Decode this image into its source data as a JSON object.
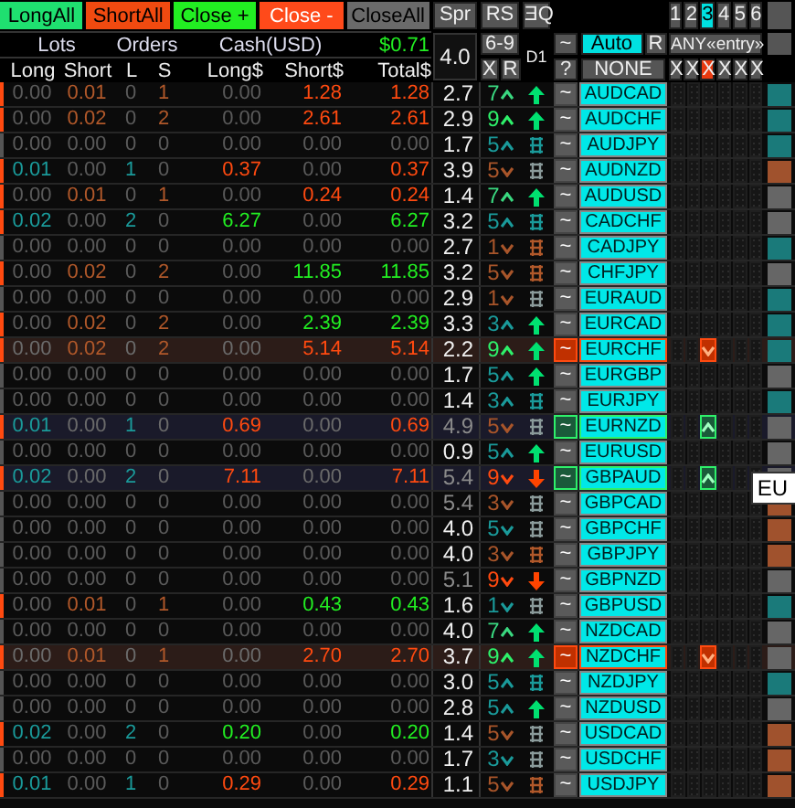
{
  "actions": [
    {
      "label": "LongAll",
      "kind": "long"
    },
    {
      "label": "ShortAll",
      "kind": "short"
    },
    {
      "label": "Close +",
      "kind": "close_profit"
    },
    {
      "label": "Close -",
      "kind": "close_loss"
    },
    {
      "label": "CloseAll",
      "kind": "close_all"
    }
  ],
  "sort_buttons": [
    "Spr",
    "RS",
    "ƎQ"
  ],
  "pages": [
    {
      "label": "1",
      "selected": false
    },
    {
      "label": "2",
      "selected": false
    },
    {
      "label": "3",
      "selected": true
    },
    {
      "label": "4",
      "selected": false
    },
    {
      "label": "5",
      "selected": false
    },
    {
      "label": "6",
      "selected": false
    }
  ],
  "summary": {
    "lots": "Lots",
    "orders": "Orders",
    "cash": "Cash(USD)",
    "total": "$0.71"
  },
  "column_headers": [
    "Long",
    "Short",
    "L",
    "S",
    "Long$",
    "Short$",
    "Total$"
  ],
  "spread": "4.0",
  "rs_range": "6-9",
  "rs_buttons": [
    "X",
    "R"
  ],
  "timeframe": "D1",
  "mode_buttons": [
    "~",
    "?"
  ],
  "auto": {
    "label": "Auto",
    "selected": true
  },
  "auto_reset": "R",
  "filter": "NONE",
  "entry": "ANY«entry»",
  "slot_buttons": [
    {
      "label": "X",
      "selected": false
    },
    {
      "label": "X",
      "selected": false
    },
    {
      "label": "X",
      "selected": true
    },
    {
      "label": "X",
      "selected": false
    },
    {
      "label": "X",
      "selected": false
    },
    {
      "label": "X",
      "selected": false
    }
  ],
  "rows": [
    {
      "pair": "AUDCAD",
      "toggle": "~",
      "long": "0.00",
      "short": "0.01",
      "l": "0",
      "s": "1",
      "long_usd": "0.00",
      "short_usd": "1.28",
      "total": "1.28",
      "has_long": false,
      "has_short": true,
      "profit": false,
      "spread": "2.7",
      "wide_spread": false,
      "rs": {
        "value": "7",
        "kind": "up",
        "color": "#3ad880"
      },
      "trend": {
        "kind": "up",
        "color": "#00e070"
      },
      "sell_signal": false,
      "buy_signal": false,
      "slots": [
        {
          "kind": "off"
        },
        {
          "kind": "off"
        },
        {
          "kind": "off"
        },
        {
          "kind": "off"
        },
        {
          "kind": "off"
        },
        {
          "kind": "off"
        }
      ],
      "tag": {
        "color": "#1a7a7a"
      }
    },
    {
      "pair": "AUDCHF",
      "toggle": "~",
      "long": "0.00",
      "short": "0.02",
      "l": "0",
      "s": "2",
      "long_usd": "0.00",
      "short_usd": "2.61",
      "total": "2.61",
      "has_long": false,
      "has_short": true,
      "profit": false,
      "spread": "2.9",
      "wide_spread": false,
      "rs": {
        "value": "9",
        "kind": "up",
        "color": "#2ef06a"
      },
      "trend": {
        "kind": "up",
        "color": "#00e070"
      },
      "sell_signal": false,
      "buy_signal": false,
      "slots": [
        {
          "kind": "off"
        },
        {
          "kind": "off"
        },
        {
          "kind": "off"
        },
        {
          "kind": "off"
        },
        {
          "kind": "off"
        },
        {
          "kind": "off"
        }
      ],
      "tag": {
        "color": "#1a7a7a"
      }
    },
    {
      "pair": "AUDJPY",
      "toggle": "~",
      "long": "0.00",
      "short": "0.00",
      "l": "0",
      "s": "0",
      "long_usd": "0.00",
      "short_usd": "0.00",
      "total": "0.00",
      "has_long": false,
      "has_short": false,
      "profit": false,
      "spread": "1.7",
      "wide_spread": false,
      "rs": {
        "value": "5",
        "kind": "up",
        "color": "#1a9a9a"
      },
      "trend": {
        "kind": "mixed",
        "color": "#1a9a9a"
      },
      "sell_signal": false,
      "buy_signal": false,
      "slots": [
        {
          "kind": "off"
        },
        {
          "kind": "off"
        },
        {
          "kind": "off"
        },
        {
          "kind": "off"
        },
        {
          "kind": "off"
        },
        {
          "kind": "off"
        }
      ],
      "tag": {
        "color": "#1a7a7a"
      }
    },
    {
      "pair": "AUDNZD",
      "toggle": "~",
      "long": "0.01",
      "short": "0.00",
      "l": "1",
      "s": "0",
      "long_usd": "0.37",
      "short_usd": "0.00",
      "total": "0.37",
      "has_long": true,
      "has_short": false,
      "profit": false,
      "spread": "3.9",
      "wide_spread": false,
      "rs": {
        "value": "5",
        "kind": "down",
        "color": "#a8552a"
      },
      "trend": {
        "kind": "mixed",
        "color": "#8a9a9a"
      },
      "sell_signal": false,
      "buy_signal": false,
      "slots": [
        {
          "kind": "off"
        },
        {
          "kind": "off"
        },
        {
          "kind": "off"
        },
        {
          "kind": "off"
        },
        {
          "kind": "off"
        },
        {
          "kind": "off"
        }
      ],
      "tag": {
        "color": "#a0522d"
      }
    },
    {
      "pair": "AUDUSD",
      "toggle": "~",
      "long": "0.00",
      "short": "0.01",
      "l": "0",
      "s": "1",
      "long_usd": "0.00",
      "short_usd": "0.24",
      "total": "0.24",
      "has_long": false,
      "has_short": true,
      "profit": false,
      "spread": "1.4",
      "wide_spread": false,
      "rs": {
        "value": "7",
        "kind": "up",
        "color": "#3ad880"
      },
      "trend": {
        "kind": "up",
        "color": "#00e070"
      },
      "sell_signal": false,
      "buy_signal": false,
      "slots": [
        {
          "kind": "off"
        },
        {
          "kind": "off"
        },
        {
          "kind": "off"
        },
        {
          "kind": "off"
        },
        {
          "kind": "off"
        },
        {
          "kind": "off"
        }
      ],
      "tag": {
        "color": "#666666"
      }
    },
    {
      "pair": "CADCHF",
      "toggle": "~",
      "long": "0.02",
      "short": "0.00",
      "l": "2",
      "s": "0",
      "long_usd": "6.27",
      "short_usd": "0.00",
      "total": "6.27",
      "has_long": true,
      "has_short": false,
      "profit": true,
      "spread": "3.2",
      "wide_spread": false,
      "rs": {
        "value": "5",
        "kind": "up",
        "color": "#1a9a9a"
      },
      "trend": {
        "kind": "mixed",
        "color": "#1a9a9a"
      },
      "sell_signal": false,
      "buy_signal": false,
      "slots": [
        {
          "kind": "off"
        },
        {
          "kind": "off"
        },
        {
          "kind": "off"
        },
        {
          "kind": "off"
        },
        {
          "kind": "off"
        },
        {
          "kind": "off"
        }
      ],
      "tag": {
        "color": "#666666"
      }
    },
    {
      "pair": "CADJPY",
      "toggle": "~",
      "long": "0.00",
      "short": "0.00",
      "l": "0",
      "s": "0",
      "long_usd": "0.00",
      "short_usd": "0.00",
      "total": "0.00",
      "has_long": false,
      "has_short": false,
      "profit": false,
      "spread": "2.7",
      "wide_spread": false,
      "rs": {
        "value": "1",
        "kind": "down",
        "color": "#a8552a"
      },
      "trend": {
        "kind": "mixed",
        "color": "#b0582a"
      },
      "sell_signal": false,
      "buy_signal": false,
      "slots": [
        {
          "kind": "off"
        },
        {
          "kind": "off"
        },
        {
          "kind": "off"
        },
        {
          "kind": "off"
        },
        {
          "kind": "off"
        },
        {
          "kind": "off"
        }
      ],
      "tag": {
        "color": "#1a7a7a"
      }
    },
    {
      "pair": "CHFJPY",
      "toggle": "~",
      "long": "0.00",
      "short": "0.02",
      "l": "0",
      "s": "2",
      "long_usd": "0.00",
      "short_usd": "11.85",
      "total": "11.85",
      "has_long": false,
      "has_short": true,
      "profit": true,
      "spread": "3.2",
      "wide_spread": false,
      "rs": {
        "value": "5",
        "kind": "down",
        "color": "#a8552a"
      },
      "trend": {
        "kind": "mixed",
        "color": "#b0582a"
      },
      "sell_signal": false,
      "buy_signal": false,
      "slots": [
        {
          "kind": "off"
        },
        {
          "kind": "off"
        },
        {
          "kind": "off"
        },
        {
          "kind": "off"
        },
        {
          "kind": "off"
        },
        {
          "kind": "off"
        }
      ],
      "tag": {
        "color": "#666666"
      }
    },
    {
      "pair": "EURAUD",
      "toggle": "~",
      "long": "0.00",
      "short": "0.00",
      "l": "0",
      "s": "0",
      "long_usd": "0.00",
      "short_usd": "0.00",
      "total": "0.00",
      "has_long": false,
      "has_short": false,
      "profit": false,
      "spread": "2.9",
      "wide_spread": false,
      "rs": {
        "value": "1",
        "kind": "down",
        "color": "#a8552a"
      },
      "trend": {
        "kind": "mixed",
        "color": "#8a9a9a"
      },
      "sell_signal": false,
      "buy_signal": false,
      "slots": [
        {
          "kind": "off"
        },
        {
          "kind": "off"
        },
        {
          "kind": "off"
        },
        {
          "kind": "off"
        },
        {
          "kind": "off"
        },
        {
          "kind": "off"
        }
      ],
      "tag": {
        "color": "#1a7a7a"
      }
    },
    {
      "pair": "EURCAD",
      "toggle": "~",
      "long": "0.00",
      "short": "0.02",
      "l": "0",
      "s": "2",
      "long_usd": "0.00",
      "short_usd": "2.39",
      "total": "2.39",
      "has_long": false,
      "has_short": true,
      "profit": true,
      "spread": "3.3",
      "wide_spread": false,
      "rs": {
        "value": "3",
        "kind": "up",
        "color": "#1a9a9a"
      },
      "trend": {
        "kind": "up",
        "color": "#00e070"
      },
      "sell_signal": false,
      "buy_signal": false,
      "slots": [
        {
          "kind": "off"
        },
        {
          "kind": "off"
        },
        {
          "kind": "off"
        },
        {
          "kind": "off"
        },
        {
          "kind": "off"
        },
        {
          "kind": "off"
        }
      ],
      "tag": {
        "color": "#1a7a7a"
      }
    },
    {
      "pair": "EURCHF",
      "toggle": "~",
      "long": "0.00",
      "short": "0.02",
      "l": "0",
      "s": "2",
      "long_usd": "0.00",
      "short_usd": "5.14",
      "total": "5.14",
      "has_long": false,
      "has_short": true,
      "profit": false,
      "spread": "2.2",
      "wide_spread": false,
      "rs": {
        "value": "9",
        "kind": "up",
        "color": "#2ef06a"
      },
      "trend": {
        "kind": "up",
        "color": "#00e070"
      },
      "sell_signal": true,
      "buy_signal": false,
      "slots": [
        {
          "kind": "off"
        },
        {
          "kind": "off"
        },
        {
          "kind": "sell"
        },
        {
          "kind": "off"
        },
        {
          "kind": "off"
        },
        {
          "kind": "off"
        }
      ],
      "tag": {
        "color": "#1a7a7a"
      }
    },
    {
      "pair": "EURGBP",
      "toggle": "~",
      "long": "0.00",
      "short": "0.00",
      "l": "0",
      "s": "0",
      "long_usd": "0.00",
      "short_usd": "0.00",
      "total": "0.00",
      "has_long": false,
      "has_short": false,
      "profit": false,
      "spread": "1.7",
      "wide_spread": false,
      "rs": {
        "value": "5",
        "kind": "up",
        "color": "#1a9a9a"
      },
      "trend": {
        "kind": "up",
        "color": "#00e070"
      },
      "sell_signal": false,
      "buy_signal": false,
      "slots": [
        {
          "kind": "off"
        },
        {
          "kind": "off"
        },
        {
          "kind": "off"
        },
        {
          "kind": "off"
        },
        {
          "kind": "off"
        },
        {
          "kind": "off"
        }
      ],
      "tag": {
        "color": "#666666"
      }
    },
    {
      "pair": "EURJPY",
      "toggle": "~",
      "long": "0.00",
      "short": "0.00",
      "l": "0",
      "s": "0",
      "long_usd": "0.00",
      "short_usd": "0.00",
      "total": "0.00",
      "has_long": false,
      "has_short": false,
      "profit": false,
      "spread": "1.4",
      "wide_spread": false,
      "rs": {
        "value": "3",
        "kind": "up",
        "color": "#1a9a9a"
      },
      "trend": {
        "kind": "mixed",
        "color": "#1a9a9a"
      },
      "sell_signal": false,
      "buy_signal": false,
      "slots": [
        {
          "kind": "off"
        },
        {
          "kind": "off"
        },
        {
          "kind": "off"
        },
        {
          "kind": "off"
        },
        {
          "kind": "off"
        },
        {
          "kind": "off"
        }
      ],
      "tag": {
        "color": "#1a7a7a"
      }
    },
    {
      "pair": "EURNZD",
      "toggle": "~",
      "long": "0.01",
      "short": "0.00",
      "l": "1",
      "s": "0",
      "long_usd": "0.69",
      "short_usd": "0.00",
      "total": "0.69",
      "has_long": true,
      "has_short": false,
      "profit": false,
      "spread": "4.9",
      "wide_spread": true,
      "rs": {
        "value": "5",
        "kind": "down",
        "color": "#a8552a"
      },
      "trend": {
        "kind": "mixed",
        "color": "#8a9a9a"
      },
      "sell_signal": false,
      "buy_signal": true,
      "slots": [
        {
          "kind": "off"
        },
        {
          "kind": "off"
        },
        {
          "kind": "buy"
        },
        {
          "kind": "off"
        },
        {
          "kind": "off"
        },
        {
          "kind": "off"
        }
      ],
      "tag": {
        "color": "#666666"
      }
    },
    {
      "pair": "EURUSD",
      "toggle": "~",
      "long": "0.00",
      "short": "0.00",
      "l": "0",
      "s": "0",
      "long_usd": "0.00",
      "short_usd": "0.00",
      "total": "0.00",
      "has_long": false,
      "has_short": false,
      "profit": false,
      "spread": "0.9",
      "wide_spread": false,
      "rs": {
        "value": "5",
        "kind": "up",
        "color": "#1a9a9a"
      },
      "trend": {
        "kind": "up",
        "color": "#00e070"
      },
      "sell_signal": false,
      "buy_signal": false,
      "slots": [
        {
          "kind": "off"
        },
        {
          "kind": "off"
        },
        {
          "kind": "off"
        },
        {
          "kind": "off"
        },
        {
          "kind": "off"
        },
        {
          "kind": "off"
        }
      ],
      "tag": {
        "color": "#666666"
      }
    },
    {
      "pair": "GBPAUD",
      "toggle": "~",
      "long": "0.02",
      "short": "0.00",
      "l": "2",
      "s": "0",
      "long_usd": "7.11",
      "short_usd": "0.00",
      "total": "7.11",
      "has_long": true,
      "has_short": false,
      "profit": false,
      "spread": "5.4",
      "wide_spread": true,
      "rs": {
        "value": "9",
        "kind": "down",
        "color": "#ff4a10"
      },
      "trend": {
        "kind": "down",
        "color": "#ff4400"
      },
      "sell_signal": false,
      "buy_signal": true,
      "slots": [
        {
          "kind": "off"
        },
        {
          "kind": "off"
        },
        {
          "kind": "buy"
        },
        {
          "kind": "off"
        },
        {
          "kind": "off"
        },
        {
          "kind": "off"
        }
      ],
      "tag": {
        "color": "#666666"
      },
      "tooltip": "EU"
    },
    {
      "pair": "GBPCAD",
      "toggle": "~",
      "long": "0.00",
      "short": "0.00",
      "l": "0",
      "s": "0",
      "long_usd": "0.00",
      "short_usd": "0.00",
      "total": "0.00",
      "has_long": false,
      "has_short": false,
      "profit": false,
      "spread": "5.4",
      "wide_spread": true,
      "rs": {
        "value": "3",
        "kind": "down",
        "color": "#a8552a"
      },
      "trend": {
        "kind": "mixed",
        "color": "#8a9a9a"
      },
      "sell_signal": false,
      "buy_signal": false,
      "slots": [
        {
          "kind": "off"
        },
        {
          "kind": "off"
        },
        {
          "kind": "off"
        },
        {
          "kind": "off"
        },
        {
          "kind": "off"
        },
        {
          "kind": "off"
        }
      ],
      "tag": {
        "color": "#a0522d"
      }
    },
    {
      "pair": "GBPCHF",
      "toggle": "~",
      "long": "0.00",
      "short": "0.00",
      "l": "0",
      "s": "0",
      "long_usd": "0.00",
      "short_usd": "0.00",
      "total": "0.00",
      "has_long": false,
      "has_short": false,
      "profit": false,
      "spread": "4.0",
      "wide_spread": false,
      "rs": {
        "value": "5",
        "kind": "down",
        "color": "#1a9a9a"
      },
      "trend": {
        "kind": "mixed",
        "color": "#8a9a9a"
      },
      "sell_signal": false,
      "buy_signal": false,
      "slots": [
        {
          "kind": "off"
        },
        {
          "kind": "off"
        },
        {
          "kind": "off"
        },
        {
          "kind": "off"
        },
        {
          "kind": "off"
        },
        {
          "kind": "off"
        }
      ],
      "tag": {
        "color": "#a0522d"
      }
    },
    {
      "pair": "GBPJPY",
      "toggle": "~",
      "long": "0.00",
      "short": "0.00",
      "l": "0",
      "s": "0",
      "long_usd": "0.00",
      "short_usd": "0.00",
      "total": "0.00",
      "has_long": false,
      "has_short": false,
      "profit": false,
      "spread": "4.0",
      "wide_spread": false,
      "rs": {
        "value": "3",
        "kind": "down",
        "color": "#a8552a"
      },
      "trend": {
        "kind": "mixed",
        "color": "#b0582a"
      },
      "sell_signal": false,
      "buy_signal": false,
      "slots": [
        {
          "kind": "off"
        },
        {
          "kind": "off"
        },
        {
          "kind": "off"
        },
        {
          "kind": "off"
        },
        {
          "kind": "off"
        },
        {
          "kind": "off"
        }
      ],
      "tag": {
        "color": "#a0522d"
      }
    },
    {
      "pair": "GBPNZD",
      "toggle": "~",
      "long": "0.00",
      "short": "0.00",
      "l": "0",
      "s": "0",
      "long_usd": "0.00",
      "short_usd": "0.00",
      "total": "0.00",
      "has_long": false,
      "has_short": false,
      "profit": false,
      "spread": "5.1",
      "wide_spread": true,
      "rs": {
        "value": "9",
        "kind": "down",
        "color": "#ff4a10"
      },
      "trend": {
        "kind": "down",
        "color": "#ff4400"
      },
      "sell_signal": false,
      "buy_signal": false,
      "slots": [
        {
          "kind": "off"
        },
        {
          "kind": "off"
        },
        {
          "kind": "off"
        },
        {
          "kind": "off"
        },
        {
          "kind": "off"
        },
        {
          "kind": "off"
        }
      ],
      "tag": {
        "color": "#666666"
      }
    },
    {
      "pair": "GBPUSD",
      "toggle": "~",
      "long": "0.00",
      "short": "0.01",
      "l": "0",
      "s": "1",
      "long_usd": "0.00",
      "short_usd": "0.43",
      "total": "0.43",
      "has_long": false,
      "has_short": true,
      "profit": true,
      "spread": "1.6",
      "wide_spread": false,
      "rs": {
        "value": "1",
        "kind": "down",
        "color": "#1a9a9a"
      },
      "trend": {
        "kind": "mixed",
        "color": "#8a9a9a"
      },
      "sell_signal": false,
      "buy_signal": false,
      "slots": [
        {
          "kind": "off"
        },
        {
          "kind": "off"
        },
        {
          "kind": "off"
        },
        {
          "kind": "off"
        },
        {
          "kind": "off"
        },
        {
          "kind": "off"
        }
      ],
      "tag": {
        "color": "#1a7a7a"
      }
    },
    {
      "pair": "NZDCAD",
      "toggle": "~",
      "long": "0.00",
      "short": "0.00",
      "l": "0",
      "s": "0",
      "long_usd": "0.00",
      "short_usd": "0.00",
      "total": "0.00",
      "has_long": false,
      "has_short": false,
      "profit": false,
      "spread": "4.0",
      "wide_spread": false,
      "rs": {
        "value": "7",
        "kind": "up",
        "color": "#3ad880"
      },
      "trend": {
        "kind": "up",
        "color": "#00e070"
      },
      "sell_signal": false,
      "buy_signal": false,
      "slots": [
        {
          "kind": "off"
        },
        {
          "kind": "off"
        },
        {
          "kind": "off"
        },
        {
          "kind": "off"
        },
        {
          "kind": "off"
        },
        {
          "kind": "off"
        }
      ],
      "tag": {
        "color": "#666666"
      }
    },
    {
      "pair": "NZDCHF",
      "toggle": "~",
      "long": "0.00",
      "short": "0.01",
      "l": "0",
      "s": "1",
      "long_usd": "0.00",
      "short_usd": "2.70",
      "total": "2.70",
      "has_long": false,
      "has_short": true,
      "profit": false,
      "spread": "3.7",
      "wide_spread": false,
      "rs": {
        "value": "9",
        "kind": "up",
        "color": "#2ef06a"
      },
      "trend": {
        "kind": "up",
        "color": "#00e070"
      },
      "sell_signal": true,
      "buy_signal": false,
      "slots": [
        {
          "kind": "off"
        },
        {
          "kind": "off"
        },
        {
          "kind": "sell"
        },
        {
          "kind": "off"
        },
        {
          "kind": "off"
        },
        {
          "kind": "off"
        }
      ],
      "tag": {
        "color": "#666666"
      }
    },
    {
      "pair": "NZDJPY",
      "toggle": "~",
      "long": "0.00",
      "short": "0.00",
      "l": "0",
      "s": "0",
      "long_usd": "0.00",
      "short_usd": "0.00",
      "total": "0.00",
      "has_long": false,
      "has_short": false,
      "profit": false,
      "spread": "3.0",
      "wide_spread": false,
      "rs": {
        "value": "5",
        "kind": "up",
        "color": "#1a9a9a"
      },
      "trend": {
        "kind": "mixed",
        "color": "#1a9a9a"
      },
      "sell_signal": false,
      "buy_signal": false,
      "slots": [
        {
          "kind": "off"
        },
        {
          "kind": "off"
        },
        {
          "kind": "off"
        },
        {
          "kind": "off"
        },
        {
          "kind": "off"
        },
        {
          "kind": "off"
        }
      ],
      "tag": {
        "color": "#1a7a7a"
      }
    },
    {
      "pair": "NZDUSD",
      "toggle": "~",
      "long": "0.00",
      "short": "0.00",
      "l": "0",
      "s": "0",
      "long_usd": "0.00",
      "short_usd": "0.00",
      "total": "0.00",
      "has_long": false,
      "has_short": false,
      "profit": false,
      "spread": "2.8",
      "wide_spread": false,
      "rs": {
        "value": "5",
        "kind": "up",
        "color": "#1a9a9a"
      },
      "trend": {
        "kind": "up",
        "color": "#00e070"
      },
      "sell_signal": false,
      "buy_signal": false,
      "slots": [
        {
          "kind": "off"
        },
        {
          "kind": "off"
        },
        {
          "kind": "off"
        },
        {
          "kind": "off"
        },
        {
          "kind": "off"
        },
        {
          "kind": "off"
        }
      ],
      "tag": {
        "color": "#666666"
      }
    },
    {
      "pair": "USDCAD",
      "toggle": "~",
      "long": "0.02",
      "short": "0.00",
      "l": "2",
      "s": "0",
      "long_usd": "0.20",
      "short_usd": "0.00",
      "total": "0.20",
      "has_long": true,
      "has_short": false,
      "profit": true,
      "spread": "1.4",
      "wide_spread": false,
      "rs": {
        "value": "5",
        "kind": "down",
        "color": "#a8552a"
      },
      "trend": {
        "kind": "mixed",
        "color": "#8a9a9a"
      },
      "sell_signal": false,
      "buy_signal": false,
      "slots": [
        {
          "kind": "off"
        },
        {
          "kind": "off"
        },
        {
          "kind": "off"
        },
        {
          "kind": "off"
        },
        {
          "kind": "off"
        },
        {
          "kind": "off"
        }
      ],
      "tag": {
        "color": "#a0522d"
      }
    },
    {
      "pair": "USDCHF",
      "toggle": "~",
      "long": "0.00",
      "short": "0.00",
      "l": "0",
      "s": "0",
      "long_usd": "0.00",
      "short_usd": "0.00",
      "total": "0.00",
      "has_long": false,
      "has_short": false,
      "profit": false,
      "spread": "1.7",
      "wide_spread": false,
      "rs": {
        "value": "3",
        "kind": "down",
        "color": "#1a9a9a"
      },
      "trend": {
        "kind": "mixed",
        "color": "#8a9a9a"
      },
      "sell_signal": false,
      "buy_signal": false,
      "slots": [
        {
          "kind": "off"
        },
        {
          "kind": "off"
        },
        {
          "kind": "off"
        },
        {
          "kind": "off"
        },
        {
          "kind": "off"
        },
        {
          "kind": "off"
        }
      ],
      "tag": {
        "color": "#a0522d"
      }
    },
    {
      "pair": "USDJPY",
      "toggle": "~",
      "long": "0.01",
      "short": "0.00",
      "l": "1",
      "s": "0",
      "long_usd": "0.29",
      "short_usd": "0.00",
      "total": "0.29",
      "has_long": true,
      "has_short": false,
      "profit": false,
      "spread": "1.1",
      "wide_spread": false,
      "rs": {
        "value": "5",
        "kind": "down",
        "color": "#a8552a"
      },
      "trend": {
        "kind": "mixed",
        "color": "#b0582a"
      },
      "sell_signal": false,
      "buy_signal": false,
      "slots": [
        {
          "kind": "off"
        },
        {
          "kind": "off"
        },
        {
          "kind": "off"
        },
        {
          "kind": "off"
        },
        {
          "kind": "off"
        },
        {
          "kind": "off"
        }
      ],
      "tag": {
        "color": "#a0522d"
      }
    }
  ]
}
